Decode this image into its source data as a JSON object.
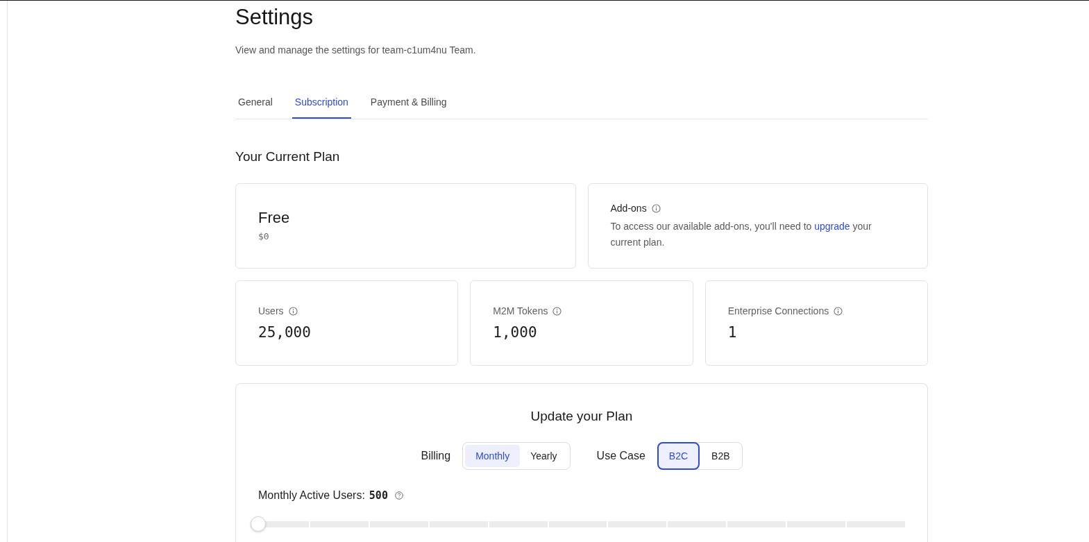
{
  "page": {
    "title": "Settings",
    "subtitle": "View and manage the settings for team-c1um4nu Team."
  },
  "tabs": [
    {
      "label": "General",
      "selected": false
    },
    {
      "label": "Subscription",
      "selected": true
    },
    {
      "label": "Payment & Billing",
      "selected": false
    }
  ],
  "current_plan": {
    "heading": "Your Current Plan",
    "plan": {
      "name": "Free",
      "price": "$0"
    },
    "addons": {
      "title": "Add-ons",
      "text_before": "To access our available add-ons, you'll need to ",
      "link": "upgrade",
      "text_after": " your current plan."
    },
    "stats": [
      {
        "label": "Users",
        "value": "25,000"
      },
      {
        "label": "M2M Tokens",
        "value": "1,000"
      },
      {
        "label": "Enterprise Connections",
        "value": "1"
      }
    ]
  },
  "update_plan": {
    "title": "Update your Plan",
    "toggles": [
      {
        "kind": "segmented",
        "label": "Billing",
        "options": [
          {
            "label": "Monthly",
            "selected": true
          },
          {
            "label": "Yearly",
            "selected": false
          }
        ]
      },
      {
        "kind": "outlined",
        "label": "Use Case",
        "options": [
          {
            "label": "B2C",
            "selected": true
          },
          {
            "label": "B2B",
            "selected": false
          }
        ]
      }
    ],
    "slider": {
      "label": "Monthly Active Users:",
      "value": "500",
      "level": 0
    }
  }
}
